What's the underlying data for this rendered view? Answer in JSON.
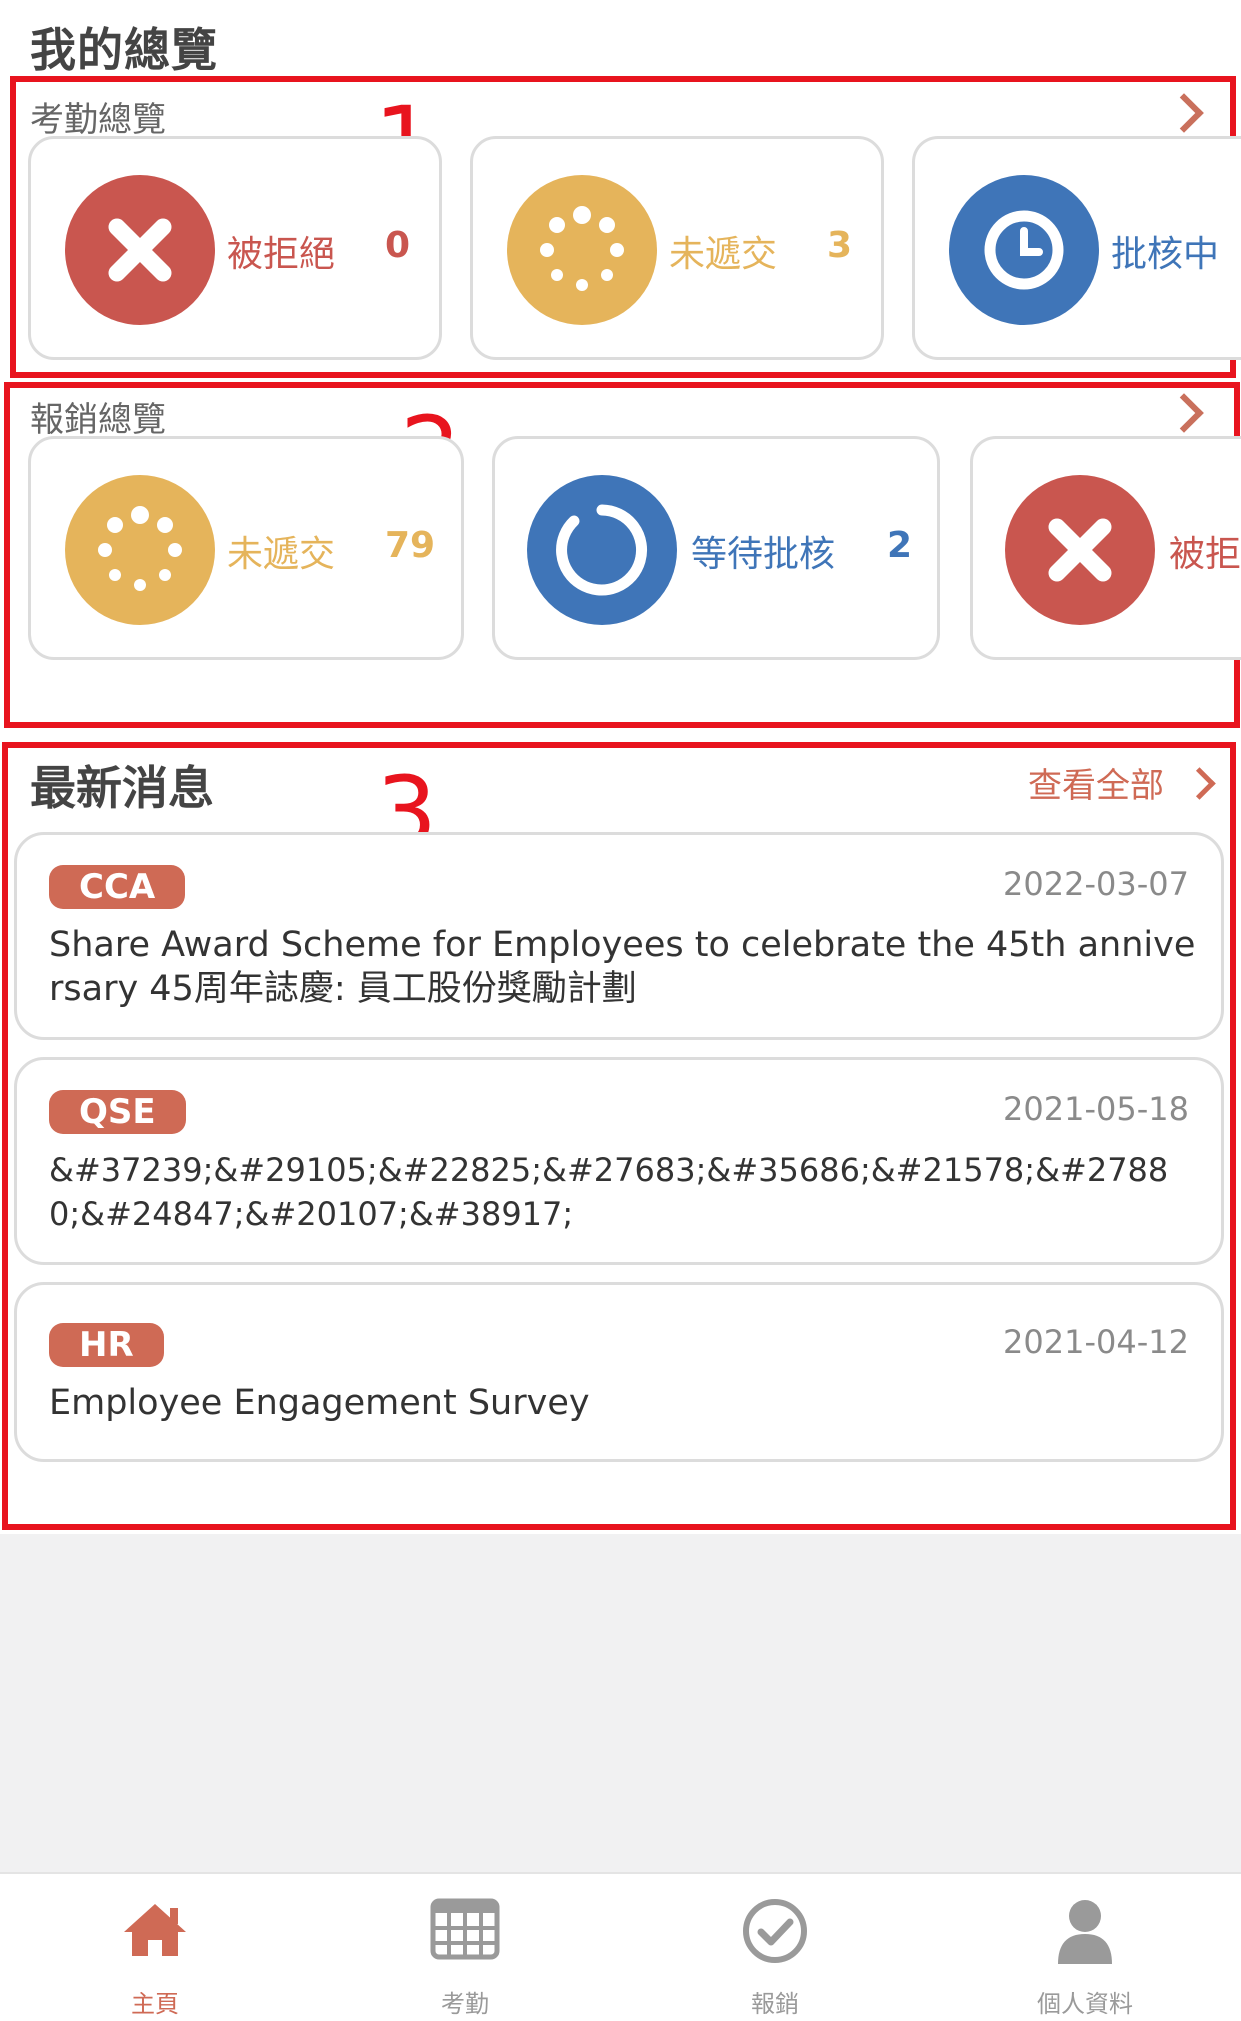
{
  "page": {
    "title": "我的總覽"
  },
  "annotations": [
    "1",
    "2",
    "3"
  ],
  "attendance": {
    "label": "考勤總覽",
    "cards": [
      {
        "label": "被拒絕",
        "count": "0",
        "icon": "close-icon",
        "color": "#c9564f"
      },
      {
        "label": "未遞交",
        "count": "3",
        "icon": "dots-loading-icon",
        "color": "#e5b45b"
      },
      {
        "label": "批核中",
        "count": "",
        "icon": "clock-icon",
        "color": "#3f75b8"
      }
    ]
  },
  "claims": {
    "label": "報銷總覽",
    "cards": [
      {
        "label": "未遞交",
        "count": "79",
        "icon": "dots-loading-icon",
        "color": "#e5b45b"
      },
      {
        "label": "等待批核",
        "count": "2",
        "icon": "power-ring-icon",
        "color": "#3f75b8"
      },
      {
        "label": "被拒",
        "count": "",
        "icon": "close-icon",
        "color": "#c9564f"
      }
    ]
  },
  "news": {
    "title": "最新消息",
    "view_all": "查看全部",
    "items": [
      {
        "tag": "CCA",
        "date": "2022-03-07",
        "text": "Share Award Scheme for Employees to celebrate the 45th anniversary 45周年誌慶: 員工股份獎勵計劃"
      },
      {
        "tag": "QSE",
        "date": "2021-05-18",
        "text": "&#37239;&#29105;&#22825;&#27683;&#35686;&#21578;&#27880;&#24847;&#20107;&#38917;"
      },
      {
        "tag": "HR",
        "date": "2021-04-12",
        "text": "Employee Engagement Survey"
      }
    ]
  },
  "tabs": [
    {
      "label": "主頁",
      "icon": "home-icon",
      "active": true
    },
    {
      "label": "考勤",
      "icon": "grid-calendar-icon",
      "active": false
    },
    {
      "label": "報銷",
      "icon": "check-circle-icon",
      "active": false
    },
    {
      "label": "個人資料",
      "icon": "user-icon",
      "active": false
    }
  ],
  "colors": {
    "accent": "#cf6a55",
    "annotation": "#e8141e",
    "gold": "#e5b45b",
    "blue": "#3f75b8",
    "red": "#c9564f"
  }
}
